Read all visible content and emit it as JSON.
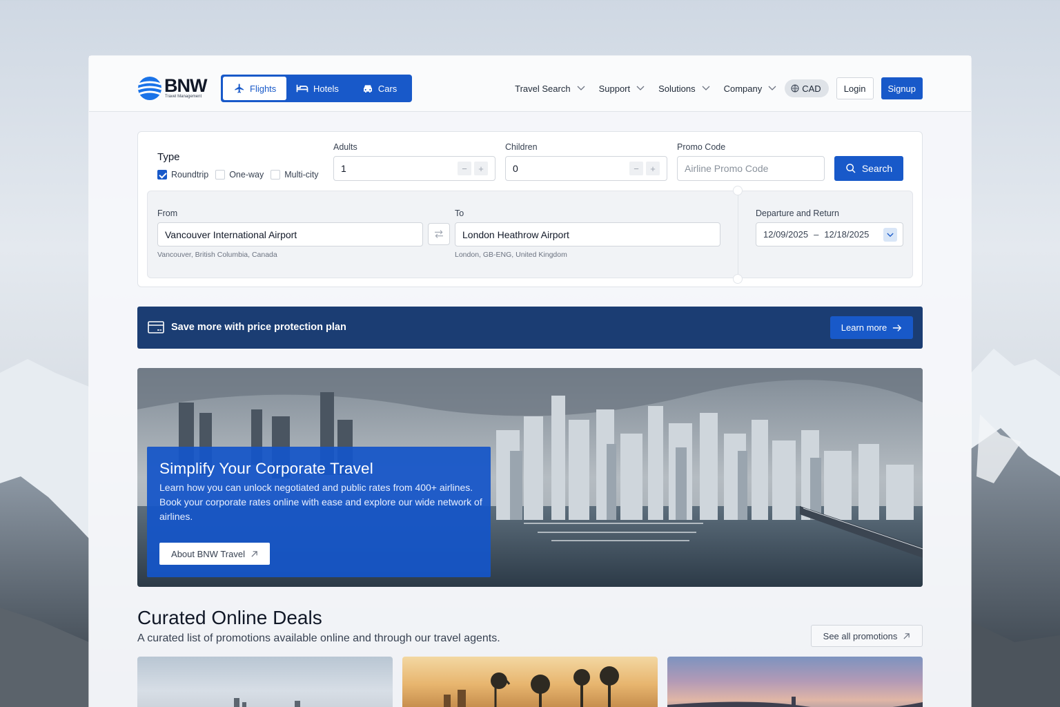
{
  "brand": {
    "name": "BNW",
    "tagline": "Travel Management"
  },
  "modes": [
    {
      "label": "Flights",
      "icon": "plane-icon",
      "active": true
    },
    {
      "label": "Hotels",
      "icon": "bed-icon",
      "active": false
    },
    {
      "label": "Cars",
      "icon": "car-icon",
      "active": false
    }
  ],
  "nav": {
    "items": [
      "Travel Search",
      "Support",
      "Solutions",
      "Company"
    ],
    "currency": "CAD",
    "login": "Login",
    "signup": "Signup"
  },
  "search": {
    "type_label": "Type",
    "trip_types": [
      {
        "label": "Roundtrip",
        "checked": true
      },
      {
        "label": "One-way",
        "checked": false
      },
      {
        "label": "Multi-city",
        "checked": false
      }
    ],
    "adults_label": "Adults",
    "adults_value": "1",
    "children_label": "Children",
    "children_value": "0",
    "promo_label": "Promo Code",
    "promo_placeholder": "Airline Promo Code",
    "search_button": "Search",
    "from_label": "From",
    "from_value": "Vancouver International Airport",
    "from_hint": "Vancouver, British Columbia, Canada",
    "to_label": "To",
    "to_value": "London Heathrow Airport",
    "to_hint": "London, GB-ENG, United Kingdom",
    "dates_label": "Departure and Return",
    "depart_date": "12/09/2025",
    "date_separator": "–",
    "return_date": "12/18/2025"
  },
  "promo_bar": {
    "text": "Save more with price protection plan",
    "button": "Learn more"
  },
  "hero": {
    "title": "Simplify Your Corporate Travel",
    "body": "Learn how you can unlock negotiated and public rates from 400+ airlines. Book your corporate rates online with ease and explore our wide network of airlines.",
    "button": "About BNW Travel"
  },
  "deals": {
    "title": "Curated Online Deals",
    "subtitle": "A curated list of promotions available online and through our travel agents.",
    "see_all": "See all promotions"
  },
  "colors": {
    "primary": "#1859c9",
    "banner": "#1b3d73"
  }
}
